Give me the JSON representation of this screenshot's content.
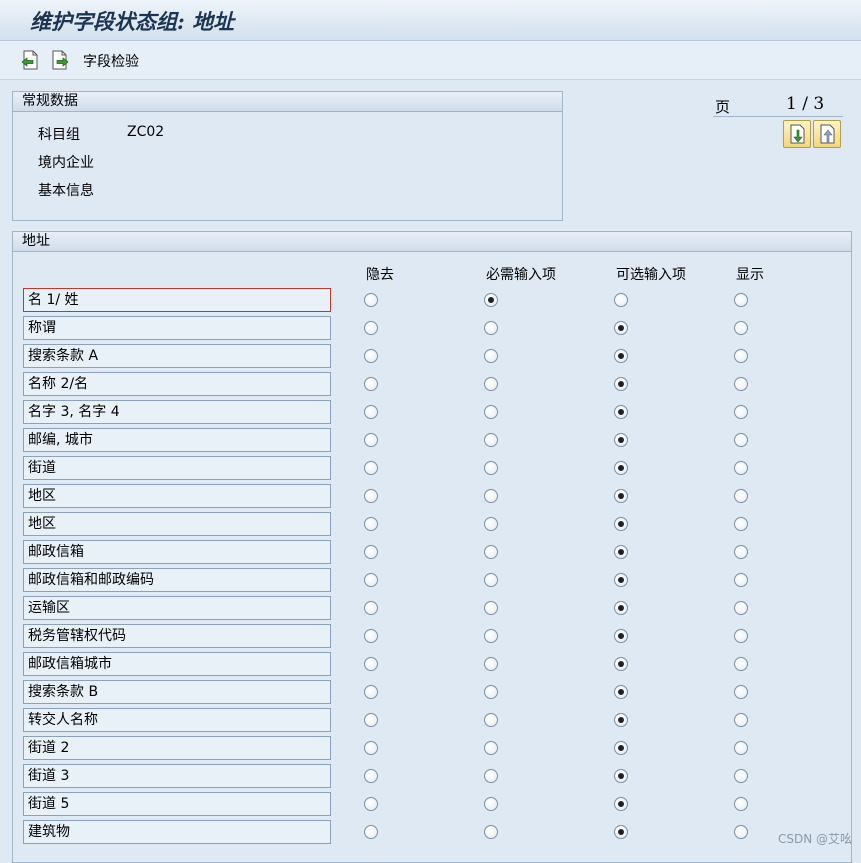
{
  "window": {
    "title": "维护字段状态组: 地址"
  },
  "toolbar": {
    "field_check_label": "字段检验"
  },
  "general": {
    "heading": "常规数据",
    "account_group_label": "科目组",
    "account_group_value": "ZC02",
    "line2": "境内企业",
    "line3": "基本信息"
  },
  "pager": {
    "label": "页",
    "text": "1 / 3"
  },
  "address": {
    "heading": "地址",
    "columns": {
      "hide": "隐去",
      "required": "必需输入项",
      "optional": "可选输入项",
      "display": "显示"
    },
    "rows": [
      {
        "label": "名 1/ 姓",
        "status": "required"
      },
      {
        "label": "称谓",
        "status": "optional"
      },
      {
        "label": "搜索条款 A",
        "status": "optional"
      },
      {
        "label": "名称 2/名",
        "status": "optional"
      },
      {
        "label": "名字 3, 名字 4",
        "status": "optional"
      },
      {
        "label": "邮编, 城市",
        "status": "optional"
      },
      {
        "label": "街道",
        "status": "optional"
      },
      {
        "label": "地区",
        "status": "optional"
      },
      {
        "label": "地区",
        "status": "optional"
      },
      {
        "label": "邮政信箱",
        "status": "optional"
      },
      {
        "label": "邮政信箱和邮政编码",
        "status": "optional"
      },
      {
        "label": "运输区",
        "status": "optional"
      },
      {
        "label": "税务管辖权代码",
        "status": "optional"
      },
      {
        "label": "邮政信箱城市",
        "status": "optional"
      },
      {
        "label": "搜索条款 B",
        "status": "optional"
      },
      {
        "label": "转交人名称",
        "status": "optional"
      },
      {
        "label": "街道 2",
        "status": "optional"
      },
      {
        "label": "街道 3",
        "status": "optional"
      },
      {
        "label": "街道 5",
        "status": "optional"
      },
      {
        "label": "建筑物",
        "status": "optional"
      }
    ]
  },
  "watermark": "CSDN @艾吆"
}
